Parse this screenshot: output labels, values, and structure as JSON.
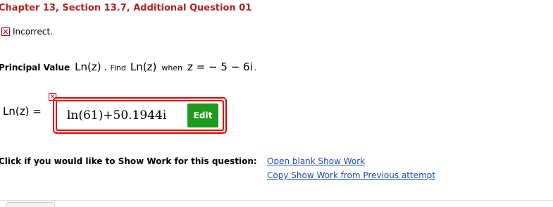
{
  "header": {
    "title": "Chapter 13, Section 13.7, Additional Question 01"
  },
  "status": {
    "icon": "x-icon",
    "text": "Incorrect."
  },
  "question": {
    "label": "Principal Value",
    "func1": "Ln(z)",
    "sep": ".",
    "find": "Find",
    "func2": "Ln(z)",
    "when": "when",
    "equation": "z = − 5 − 6i",
    "end": "."
  },
  "answer": {
    "label": "Ln(z) =",
    "value": "ln(61)+50.1944i",
    "edit_label": "Edit",
    "status_icon": "x-icon"
  },
  "show_work": {
    "prompt": "Click if you would like to Show Work for this question:",
    "open_link": "Open blank Show Work",
    "copy_link": "Copy Show Work from Previous attempt"
  },
  "colors": {
    "error": "#e00000",
    "title": "#b22222",
    "edit_button": "#1f9a1f",
    "link": "#1a4fb5"
  }
}
